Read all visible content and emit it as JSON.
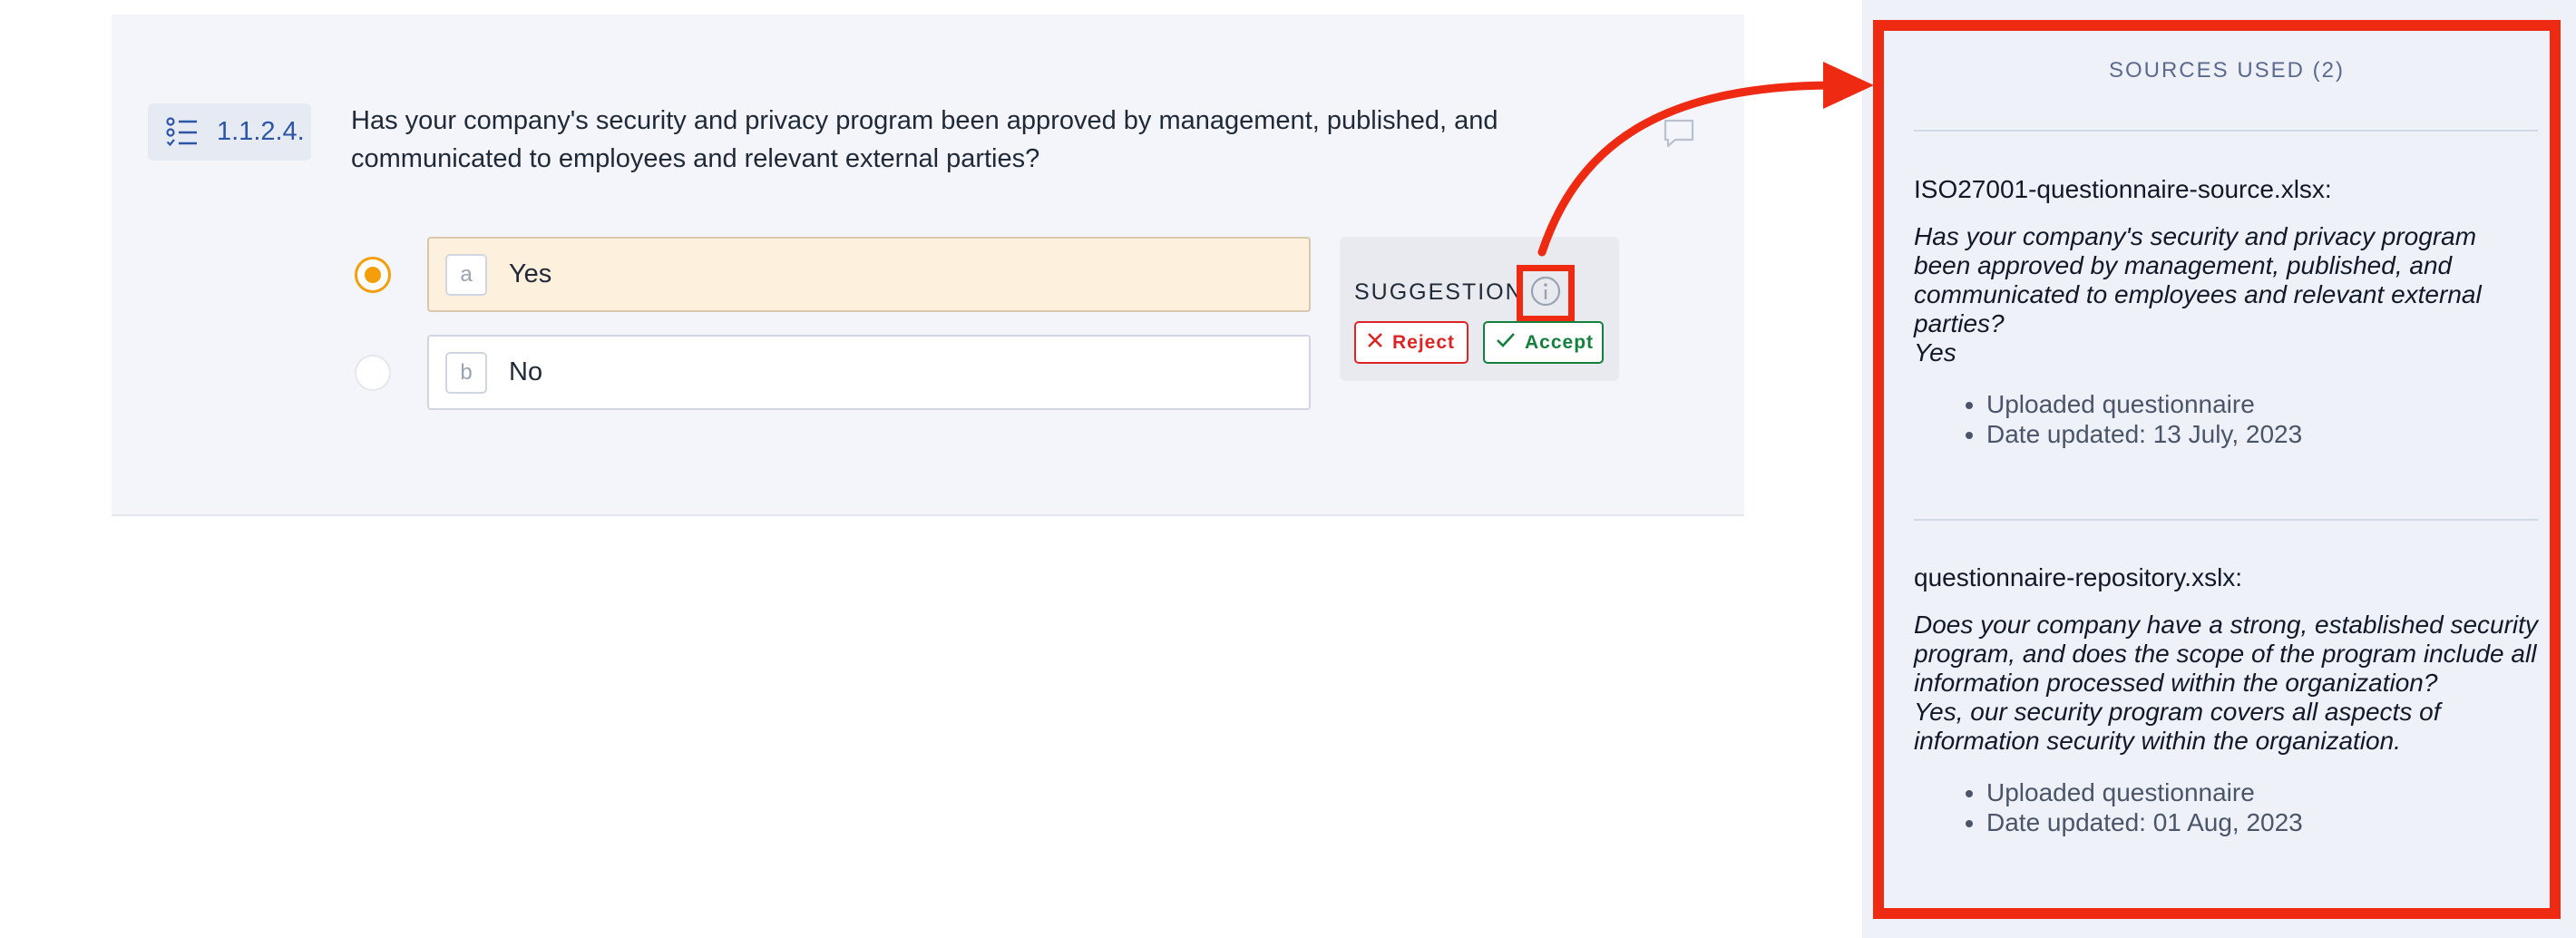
{
  "question": {
    "number": "1.1.2.4.",
    "text": "Has your company's security and privacy program been approved by management, published, and communicated to employees and relevant external parties?",
    "options": [
      {
        "letter": "a",
        "label": "Yes",
        "selected": true
      },
      {
        "letter": "b",
        "label": "No",
        "selected": false
      }
    ]
  },
  "suggestion": {
    "title": "SUGGESTION",
    "reject_label": "Reject",
    "accept_label": "Accept"
  },
  "sources": {
    "title": "SOURCES USED (2)",
    "items": [
      {
        "file": "ISO27001-questionnaire-source.xlsx:",
        "question": "Has your company's security and privacy program been approved by management, published, and communicated to employees and relevant external parties?",
        "answer": "Yes",
        "meta": [
          "Uploaded questionnaire",
          "Date updated: 13 July, 2023"
        ]
      },
      {
        "file": "questionnaire-repository.xslx:",
        "question": "Does your company have a strong, established security program, and does the scope of the program include all information processed within the organization?",
        "answer": "Yes, our security program covers all aspects of information security within the organization.",
        "meta": [
          "Uploaded questionnaire",
          "Date updated: 01 Aug, 2023"
        ]
      }
    ]
  },
  "colors": {
    "highlight": "#ef2a12",
    "accent_selected": "#f59e0b",
    "reject": "#dc2626",
    "accept": "#15803d",
    "question_number": "#2d55a6"
  }
}
